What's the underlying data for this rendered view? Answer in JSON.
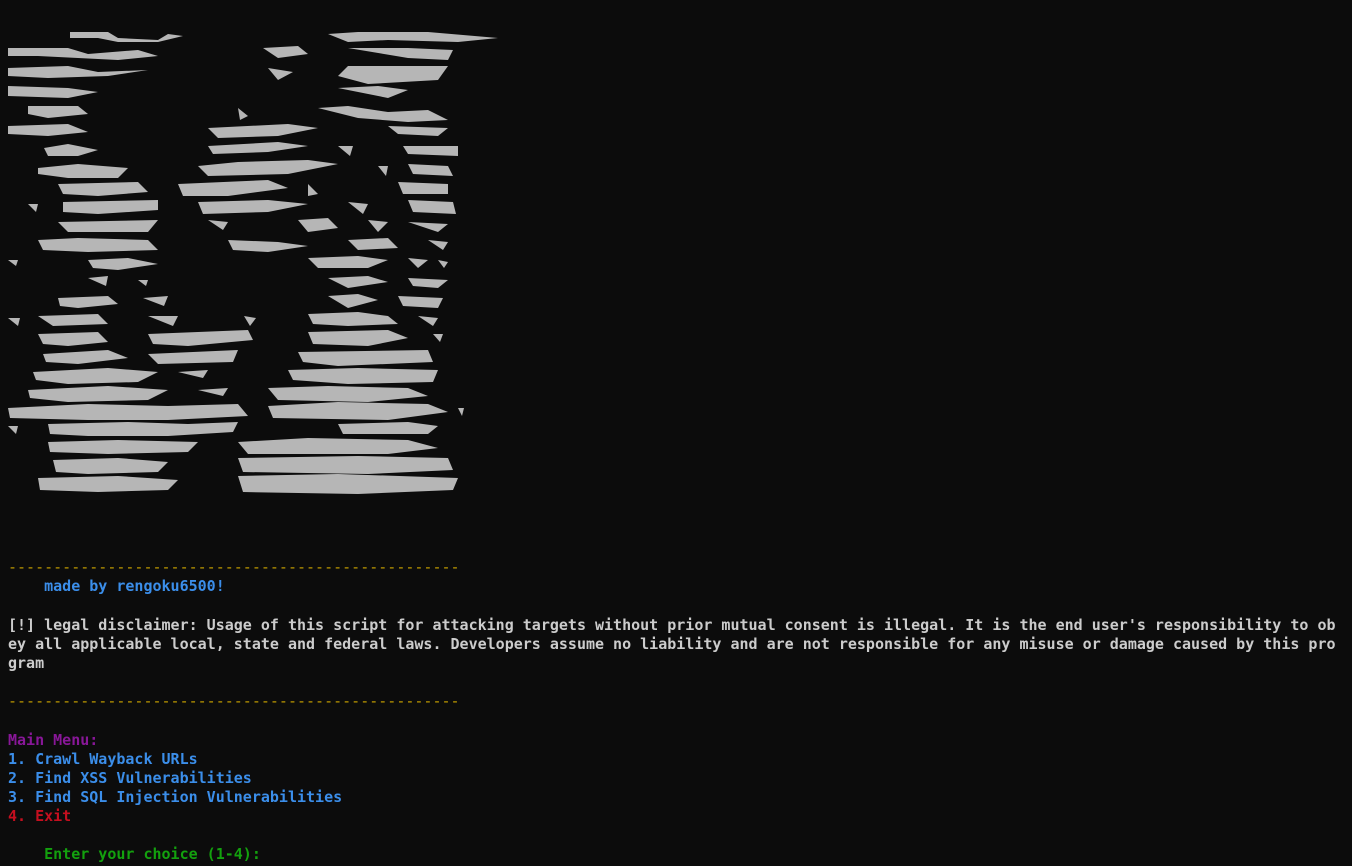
{
  "colors": {
    "background": "#0c0c0c",
    "text": "#cccccc",
    "divider": "#c19c00",
    "credit": "#3b8eea",
    "menu_title": "#881798",
    "menu_item": "#3b8eea",
    "exit": "#c50f1f",
    "prompt": "#13a10e"
  },
  "banner": {
    "divider": "--------------------------------------------------",
    "credit": "    made by rengoku6500!",
    "divider_bottom": "--------------------------------------------------"
  },
  "disclaimer": "[!] legal disclaimer: Usage of this script for attacking targets without prior mutual consent is illegal. It is the end user's responsibility to obey all applicable local, state and federal laws. Developers assume no liability and are not responsible for any misuse or damage caused by this program",
  "menu": {
    "title": "Main Menu:",
    "items": [
      "1. Crawl Wayback URLs",
      "2. Find XSS Vulnerabilities",
      "3. Find SQL Injection Vulnerabilities"
    ],
    "exit": "4. Exit",
    "prompt": "Enter your choice (1-4): "
  }
}
